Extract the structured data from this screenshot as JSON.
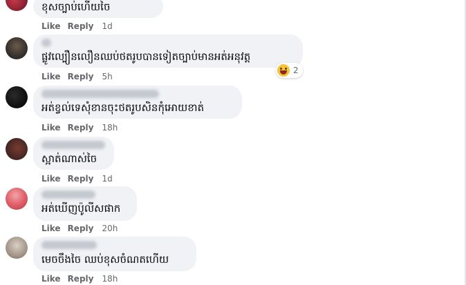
{
  "actions": {
    "like": "Like",
    "reply": "Reply"
  },
  "comments": [
    {
      "text": "ខុសច្បាប់ហើយចៃ",
      "time": "1d"
    },
    {
      "text": "ផ្លូវល្បឿនលឿនឈប់ថតរូបបានទៀតច្បាប់មានអត់អនុវត្ត",
      "time": "5h",
      "reaction": {
        "icon": "haha-emoji-icon",
        "count": "2"
      }
    },
    {
      "text": "អត់ខ្វល់ទេសុំខានចុះថតរូបសិនកុំអោយខាត់",
      "time": "18h"
    },
    {
      "text": "ស្អាត់ណាស់ចៃ",
      "time": "1d"
    },
    {
      "text": "អត់ឃើញប៉ូលីសផាក",
      "time": "20h"
    },
    {
      "text": "មេចចឹងចៃ ឈប់ខុសចំណតហើយ",
      "time": "18h"
    }
  ]
}
